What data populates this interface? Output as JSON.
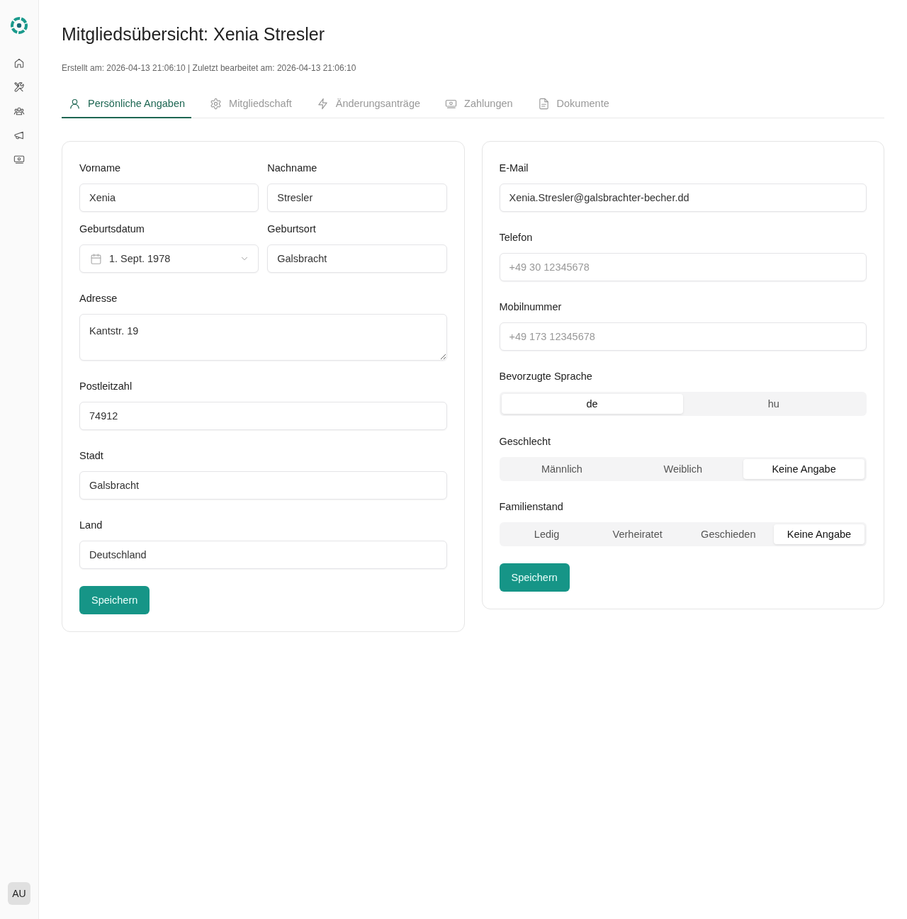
{
  "sidebar": {
    "avatar_initials": "AU"
  },
  "page": {
    "title": "Mitgliedsübersicht: Xenia Stresler",
    "meta": "Erstellt am: 2026-04-13 21:06:10 | Zuletzt bearbeitet am: 2026-04-13 21:06:10"
  },
  "tabs": [
    {
      "label": "Persönliche Angaben",
      "selected": true
    },
    {
      "label": "Mitgliedschaft",
      "selected": false
    },
    {
      "label": "Änderungsanträge",
      "selected": false
    },
    {
      "label": "Zahlungen",
      "selected": false
    },
    {
      "label": "Dokumente",
      "selected": false
    }
  ],
  "personal_form": {
    "rows": [
      [
        {
          "kind": "text",
          "label": "Vorname",
          "value": "Xenia"
        },
        {
          "kind": "text",
          "label": "Nachname",
          "value": "Stresler"
        }
      ],
      [
        {
          "kind": "date",
          "label": "Geburtsdatum",
          "value": "1. Sept. 1978"
        },
        {
          "kind": "text",
          "label": "Geburtsort",
          "value": "Galsbracht"
        }
      ],
      [
        {
          "kind": "textarea",
          "label": "Adresse",
          "value": "Kantstr. 19"
        }
      ],
      [
        {
          "kind": "text",
          "label": "Postleitzahl",
          "value": "74912"
        }
      ],
      [
        {
          "kind": "text",
          "label": "Stadt",
          "value": "Galsbracht"
        }
      ],
      [
        {
          "kind": "text",
          "label": "Land",
          "value": "Deutschland"
        }
      ]
    ],
    "save_button": "Speichern"
  },
  "contact_form": {
    "fields": [
      {
        "kind": "text",
        "label": "E-Mail",
        "value": "Xenia.Stresler@galsbrachter-becher.dd"
      },
      {
        "kind": "text",
        "label": "Telefon",
        "placeholder": "+49 30 12345678"
      },
      {
        "kind": "text",
        "label": "Mobilnummer",
        "placeholder": "+49 173 12345678"
      },
      {
        "kind": "segmented",
        "label": "Bevorzugte Sprache",
        "options": [
          {
            "label": "de",
            "selected": true
          },
          {
            "label": "hu",
            "selected": false
          }
        ]
      },
      {
        "kind": "segmented",
        "label": "Geschlecht",
        "options": [
          {
            "label": "Männlich",
            "selected": false
          },
          {
            "label": "Weiblich",
            "selected": false
          },
          {
            "label": "Keine Angabe",
            "selected": true
          }
        ]
      },
      {
        "kind": "segmented",
        "label": "Familienstand",
        "options": [
          {
            "label": "Ledig",
            "selected": false
          },
          {
            "label": "Verheiratet",
            "selected": false
          },
          {
            "label": "Geschieden",
            "selected": false
          },
          {
            "label": "Keine Angabe",
            "selected": true
          }
        ]
      }
    ],
    "save_button": "Speichern"
  }
}
